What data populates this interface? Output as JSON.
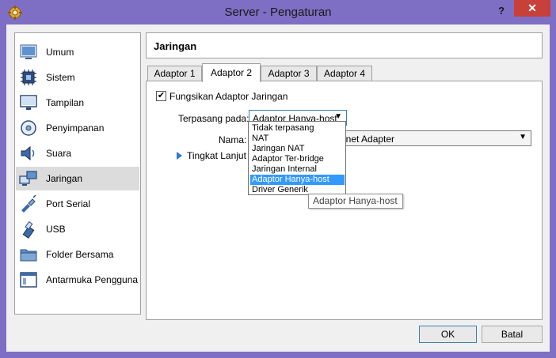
{
  "window": {
    "title": "Server - Pengaturan",
    "help_label": "?",
    "close_label": "✕"
  },
  "sidebar": {
    "items": [
      {
        "label": "Umum",
        "icon": "general-icon"
      },
      {
        "label": "Sistem",
        "icon": "chip-icon"
      },
      {
        "label": "Tampilan",
        "icon": "monitor-icon"
      },
      {
        "label": "Penyimpanan",
        "icon": "disk-icon"
      },
      {
        "label": "Suara",
        "icon": "speaker-icon"
      },
      {
        "label": "Jaringan",
        "icon": "network-icon"
      },
      {
        "label": "Port Serial",
        "icon": "serial-port-icon"
      },
      {
        "label": "USB",
        "icon": "usb-icon"
      },
      {
        "label": "Folder Bersama",
        "icon": "folder-icon"
      },
      {
        "label": "Antarmuka Pengguna",
        "icon": "ui-window-icon"
      }
    ],
    "selected": "Jaringan"
  },
  "page": {
    "title": "Jaringan",
    "tabs": [
      "Adaptor 1",
      "Adaptor 2",
      "Adaptor 3",
      "Adaptor 4"
    ],
    "active_tab": "Adaptor 2"
  },
  "adapter": {
    "enable_label": "Fungsikan Adaptor Jaringan",
    "enabled": true,
    "check_mark": "✔",
    "attached_label": "Terpasang pada:",
    "attached_value": "Adaptor Hanya-host",
    "name_label": "Nama:",
    "name_value": "ernet Adapter",
    "advanced_label": "Tingkat Lanjut",
    "dropdown_arrow": "▼"
  },
  "dropdown": {
    "options": [
      "Tidak terpasang",
      "NAT",
      "Jaringan NAT",
      "Adaptor Ter-bridge",
      "Jaringan Internal",
      "Adaptor Hanya-host",
      "Driver Generik"
    ],
    "highlighted": "Adaptor Hanya-host"
  },
  "tooltip": {
    "text": "Adaptor Hanya-host"
  },
  "buttons": {
    "ok": "OK",
    "cancel": "Batal"
  },
  "colors": {
    "titlebar": "#7e6ec4",
    "close": "#c7403a",
    "highlight": "#3399ff"
  }
}
